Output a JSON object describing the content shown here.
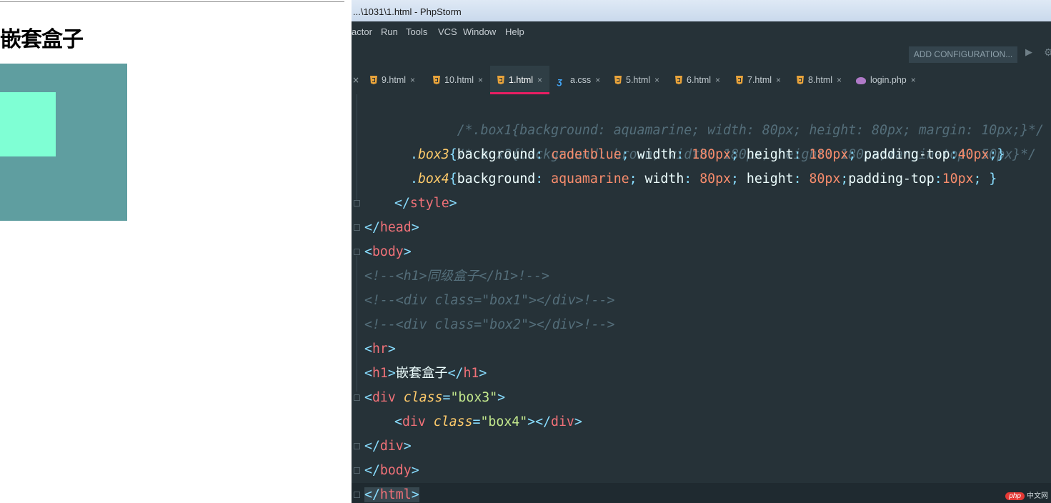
{
  "preview": {
    "heading": "嵌套盒子",
    "box3_color": "#5f9ea0",
    "box4_color": "#7fffd4"
  },
  "window": {
    "title": "...\\1031\\1.html - PhpStorm"
  },
  "menu": {
    "items": [
      "actor",
      "Run",
      "Tools",
      "VCS",
      "Window",
      "Help"
    ]
  },
  "toolbar": {
    "add_configuration": "ADD CONFIGURATION...",
    "run_icon": "play-icon",
    "settings_icon": "gear-icon"
  },
  "tabs": {
    "items": [
      {
        "label": "9.html",
        "icon": "html5-icon",
        "active": false
      },
      {
        "label": "10.html",
        "icon": "html5-icon",
        "active": false
      },
      {
        "label": "1.html",
        "icon": "html5-icon",
        "active": true
      },
      {
        "label": "a.css",
        "icon": "css3-icon",
        "active": false
      },
      {
        "label": "5.html",
        "icon": "html5-icon",
        "active": false
      },
      {
        "label": "6.html",
        "icon": "html5-icon",
        "active": false
      },
      {
        "label": "7.html",
        "icon": "html5-icon",
        "active": false
      },
      {
        "label": "8.html",
        "icon": "html5-icon",
        "active": false
      },
      {
        "label": "login.php",
        "icon": "php-elephant-icon",
        "active": false
      }
    ],
    "close_glyph": "×"
  },
  "code": {
    "l1": "/*.box1{background: aquamarine; width: 80px; height: 80px; margin: 10px;}*/",
    "l2": "/*.box2{background: brown; width: 180px; height: 180px;margin-top: 50px}*/",
    "l3": {
      "dot": ".",
      "sel": "box3",
      "b1": "{",
      "p1": "background",
      "c1": ": ",
      "v1": "cadetblue",
      "s1": "; ",
      "p2": "width",
      "c2": ": ",
      "v2": "180px",
      "s2": "; ",
      "p3": "height",
      "c3": ": ",
      "v3": "180px",
      "s3": "; ",
      "p4": "padding-top",
      "c4": ":",
      "v4": "40px",
      "s4": ";",
      "b2": "}"
    },
    "l4": {
      "dot": ".",
      "sel": "box4",
      "b1": "{",
      "p1": "background",
      "c1": ": ",
      "v1": "aquamarine",
      "s1": "; ",
      "p2": "width",
      "c2": ": ",
      "v2": "80px",
      "s2": "; ",
      "p3": "height",
      "c3": ": ",
      "v3": "80px",
      "s3": ";",
      "p4": "padding-top",
      "c4": ":",
      "v4": "10px",
      "s4": "; ",
      "b2": "}"
    },
    "l5": {
      "open": "</",
      "tag": "style",
      "close": ">"
    },
    "l6": {
      "open": "</",
      "tag": "head",
      "close": ">"
    },
    "l7": {
      "open": "<",
      "tag": "body",
      "close": ">"
    },
    "l8": "<!--<h1>同级盒子</h1>!-->",
    "l9": "<!--<div class=\"box1\"></div>!-->",
    "l10": "<!--<div class=\"box2\"></div>!-->",
    "l11": {
      "open": "<",
      "tag": "hr",
      "close": ">"
    },
    "l12": {
      "o1": "<",
      "tag1": "h1",
      "c1": ">",
      "text": "嵌套盒子",
      "o2": "</",
      "tag2": "h1",
      "c2": ">"
    },
    "l13": {
      "o1": "<",
      "tag": "div",
      "sp": " ",
      "attr": "class",
      "eq": "=",
      "val": "\"box3\"",
      "c1": ">"
    },
    "l14": {
      "o1": "<",
      "tag": "div",
      "sp": " ",
      "attr": "class",
      "eq": "=",
      "val": "\"box4\"",
      "c1": ">",
      "o2": "</",
      "tag2": "div",
      "c2": ">"
    },
    "l15": {
      "open": "</",
      "tag": "div",
      "close": ">"
    },
    "l16": {
      "open": "</",
      "tag": "body",
      "close": ">"
    },
    "l17": {
      "open": "</",
      "tag": "html",
      "close": ">"
    }
  },
  "watermark": {
    "logo": "php",
    "text": "中文网"
  }
}
